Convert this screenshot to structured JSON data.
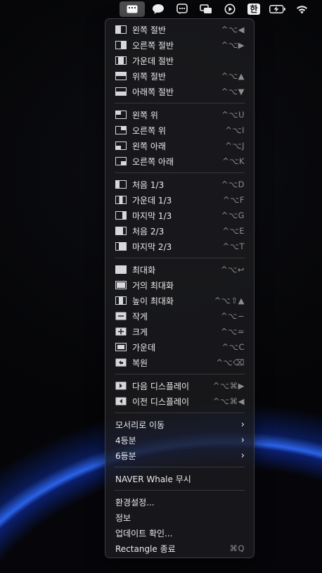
{
  "menubar": {
    "items": [
      {
        "name": "rectangle-icon",
        "active": true
      },
      {
        "name": "messages-icon"
      },
      {
        "name": "chat-bubble-icon"
      },
      {
        "name": "window-overlap-icon"
      },
      {
        "name": "play-circle-icon"
      },
      {
        "name": "input-source-korean",
        "text": "한"
      },
      {
        "name": "battery-charging-icon"
      },
      {
        "name": "wifi-icon"
      }
    ]
  },
  "menu": {
    "group1": [
      {
        "label": "왼쪽 절반",
        "shortcut": "^⌥◀",
        "icon": "left-half"
      },
      {
        "label": "오른쪽 절반",
        "shortcut": "^⌥▶",
        "icon": "right-half"
      },
      {
        "label": "가운데 절반",
        "shortcut": "",
        "icon": "center-half"
      },
      {
        "label": "위쪽 절반",
        "shortcut": "^⌥▲",
        "icon": "top-half"
      },
      {
        "label": "아래쪽 절반",
        "shortcut": "^⌥▼",
        "icon": "bottom-half"
      }
    ],
    "group2": [
      {
        "label": "왼쪽 위",
        "shortcut": "^⌥U",
        "icon": "top-left"
      },
      {
        "label": "오른쪽 위",
        "shortcut": "^⌥I",
        "icon": "top-right"
      },
      {
        "label": "왼쪽 아래",
        "shortcut": "^⌥J",
        "icon": "bottom-left"
      },
      {
        "label": "오른쪽 아래",
        "shortcut": "^⌥K",
        "icon": "bottom-right"
      }
    ],
    "group3": [
      {
        "label": "처음 1/3",
        "shortcut": "^⌥D",
        "icon": "first-third"
      },
      {
        "label": "가운데 1/3",
        "shortcut": "^⌥F",
        "icon": "center-third"
      },
      {
        "label": "마지막 1/3",
        "shortcut": "^⌥G",
        "icon": "last-third"
      },
      {
        "label": "처음 2/3",
        "shortcut": "^⌥E",
        "icon": "first-two-thirds"
      },
      {
        "label": "마지막 2/3",
        "shortcut": "^⌥T",
        "icon": "last-two-thirds"
      }
    ],
    "group4": [
      {
        "label": "최대화",
        "shortcut": "^⌥↩",
        "icon": "maximize"
      },
      {
        "label": "거의 최대화",
        "shortcut": "",
        "icon": "almost-maximize"
      },
      {
        "label": "높이 최대화",
        "shortcut": "^⌥⇧▲",
        "icon": "maximize-height"
      },
      {
        "label": "작게",
        "shortcut": "^⌥−",
        "icon": "smaller"
      },
      {
        "label": "크게",
        "shortcut": "^⌥=",
        "icon": "larger"
      },
      {
        "label": "가운데",
        "shortcut": "^⌥C",
        "icon": "center"
      },
      {
        "label": "복원",
        "shortcut": "^⌥⌫",
        "icon": "restore"
      }
    ],
    "group5": [
      {
        "label": "다음 디스플레이",
        "shortcut": "^⌥⌘▶",
        "icon": "next-display"
      },
      {
        "label": "이전 디스플레이",
        "shortcut": "^⌥⌘◀",
        "icon": "previous-display"
      }
    ],
    "group6": [
      {
        "label": "모서리로 이동",
        "submenu": "›"
      },
      {
        "label": "4등분",
        "submenu": "›"
      },
      {
        "label": "6등분",
        "submenu": "›"
      }
    ],
    "group7": [
      {
        "label": "NAVER Whale 무시"
      }
    ],
    "group8": [
      {
        "label": "환경설정..."
      },
      {
        "label": "정보"
      },
      {
        "label": "업데이트 확인..."
      },
      {
        "label": "Rectangle 종료",
        "shortcut": "⌘Q"
      }
    ]
  }
}
